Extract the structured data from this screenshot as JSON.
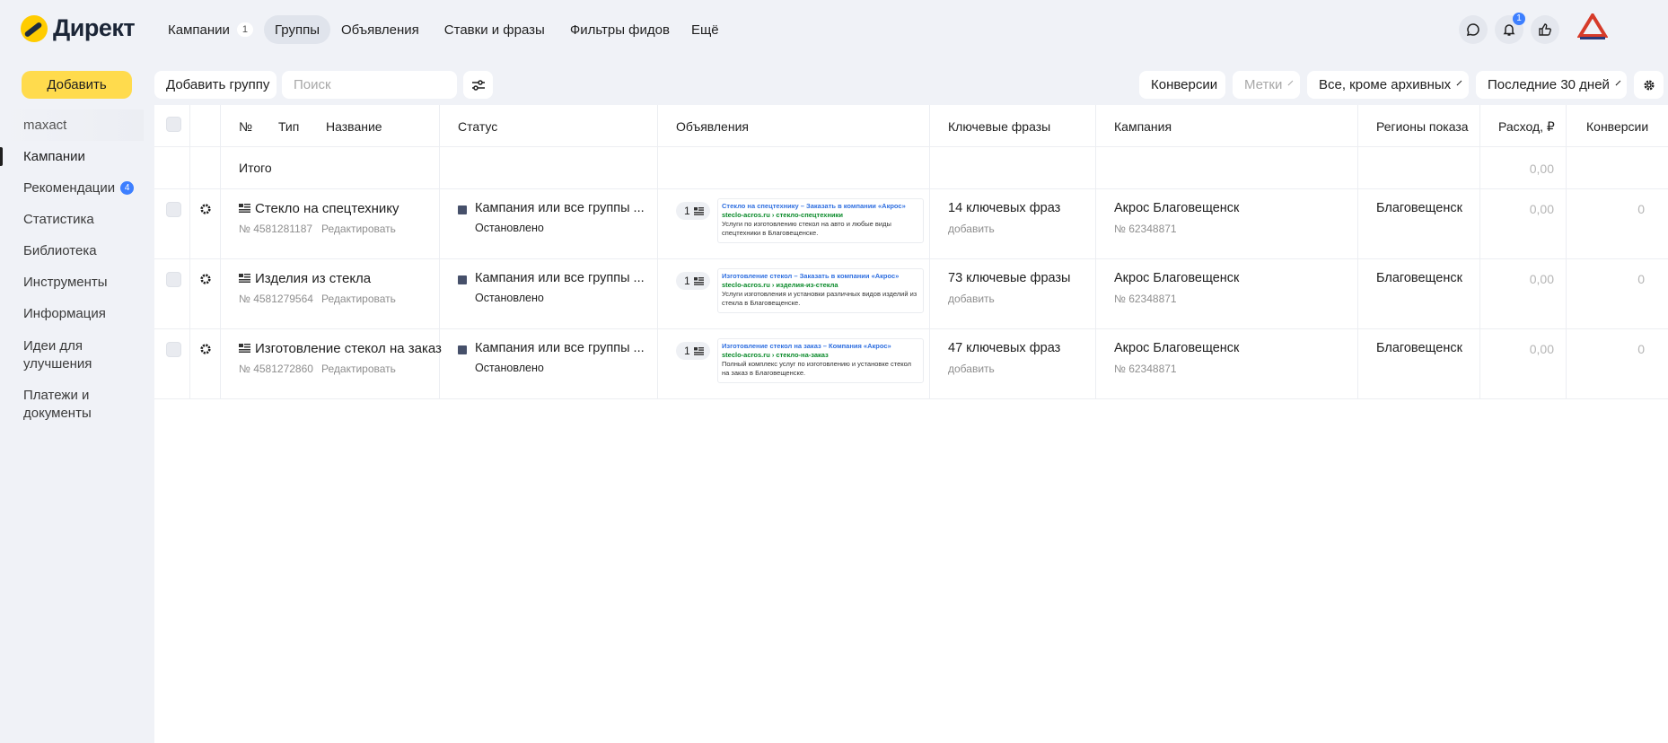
{
  "header": {
    "logo_text": "Директ",
    "nav": [
      {
        "label": "Кампании",
        "count": "1"
      },
      {
        "label": "Группы",
        "active": true
      },
      {
        "label": "Объявления"
      },
      {
        "label": "Ставки и фразы"
      },
      {
        "label": "Фильтры фидов"
      },
      {
        "label": "Ещё"
      }
    ],
    "notifications_count": "1"
  },
  "sidebar": {
    "add_label": "Добавить",
    "items": [
      {
        "label": "maxact"
      },
      {
        "label": "Кампании"
      },
      {
        "label": "Рекомендации",
        "badge": "4"
      },
      {
        "label": "Статистика"
      },
      {
        "label": "Библиотека"
      },
      {
        "label": "Инструменты"
      },
      {
        "label": "Информация"
      },
      {
        "label": "Идеи для улучшения"
      },
      {
        "label": "Платежи и документы"
      }
    ]
  },
  "toolbar": {
    "add_group_label": "Добавить группу",
    "search_placeholder": "Поиск",
    "conversions_label": "Конверсии",
    "tags_label": "Метки",
    "archive_filter_label": "Все, кроме архивных",
    "period_label": "Последние 30 дней"
  },
  "table": {
    "headers": {
      "number": "№",
      "type": "Тип",
      "name": "Название",
      "status": "Статус",
      "ads": "Объявления",
      "keywords": "Ключевые фразы",
      "campaign": "Кампания",
      "regions": "Регионы показа",
      "spend": "Расход, ₽",
      "conversions": "Конверсии"
    },
    "total": {
      "label": "Итого",
      "spend": "0,00"
    },
    "rows": [
      {
        "name": "Стекло на спецтехнику",
        "id": "№ 4581281187",
        "edit": "Редактировать",
        "status": "Кампания или все группы ...",
        "status_sub": "Остановлено",
        "ads_count": "1",
        "ad_title": "Стекло на спецтехнику – Заказать в компании «Акрос»",
        "ad_url": "steclo-acros.ru › стекло-спецтехники",
        "ad_text": "Услуги по изготовлению стекол на авто и любые виды спецтехники в Благовещенске.",
        "keywords": "14 ключевых фраз",
        "keywords_add": "добавить",
        "campaign": "Акрос Благовещенск",
        "campaign_id": "№ 62348871",
        "region": "Благовещенск",
        "spend": "0,00",
        "conversions": "0"
      },
      {
        "name": "Изделия из стекла",
        "id": "№ 4581279564",
        "edit": "Редактировать",
        "status": "Кампания или все группы ...",
        "status_sub": "Остановлено",
        "ads_count": "1",
        "ad_title": "Изготовление стекол – Заказать в компании «Акрос»",
        "ad_url": "steclo-acros.ru › изделия-из-стекла",
        "ad_text": "Услуги изготовления и установки различных видов изделий из стекла в Благовещенске.",
        "keywords": "73 ключевые фразы",
        "keywords_add": "добавить",
        "campaign": "Акрос Благовещенск",
        "campaign_id": "№ 62348871",
        "region": "Благовещенск",
        "spend": "0,00",
        "conversions": "0"
      },
      {
        "name": "Изготовление стекол на заказ",
        "id": "№ 4581272860",
        "edit": "Редактировать",
        "status": "Кампания или все группы ...",
        "status_sub": "Остановлено",
        "ads_count": "1",
        "ad_title": "Изготовление стекол на заказ – Компания «Акрос»",
        "ad_url": "steclo-acros.ru › стекло-на-заказ",
        "ad_text": "Полный комплекс услуг по изготовлению и установке стекол на заказ в Благовещенске.",
        "keywords": "47 ключевых фраз",
        "keywords_add": "добавить",
        "campaign": "Акрос Благовещенск",
        "campaign_id": "№ 62348871",
        "region": "Благовещенск",
        "spend": "0,00",
        "conversions": "0"
      }
    ]
  },
  "colors": {
    "accent_yellow": "#ffdb4d",
    "badge_blue": "#3d7fff",
    "background": "#f0f2f7"
  }
}
